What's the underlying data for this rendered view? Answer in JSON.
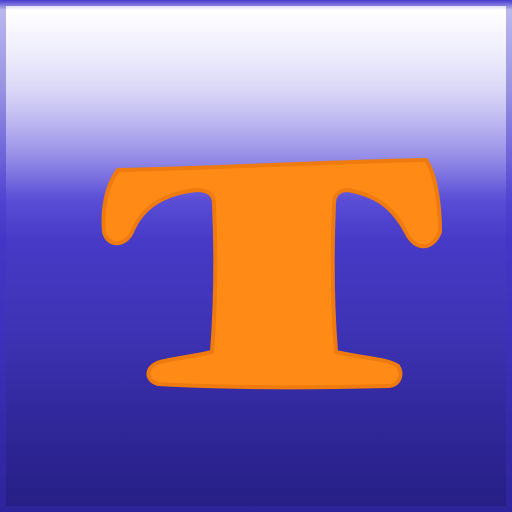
{
  "icon": {
    "glyph_letter": "T",
    "glyph_color": "#ff8a16",
    "glyph_edge_color": "#ef7a0e",
    "background_top_color": "#ffffff",
    "background_mid_color": "#4a3fd0",
    "background_bottom_color": "#261e84"
  }
}
